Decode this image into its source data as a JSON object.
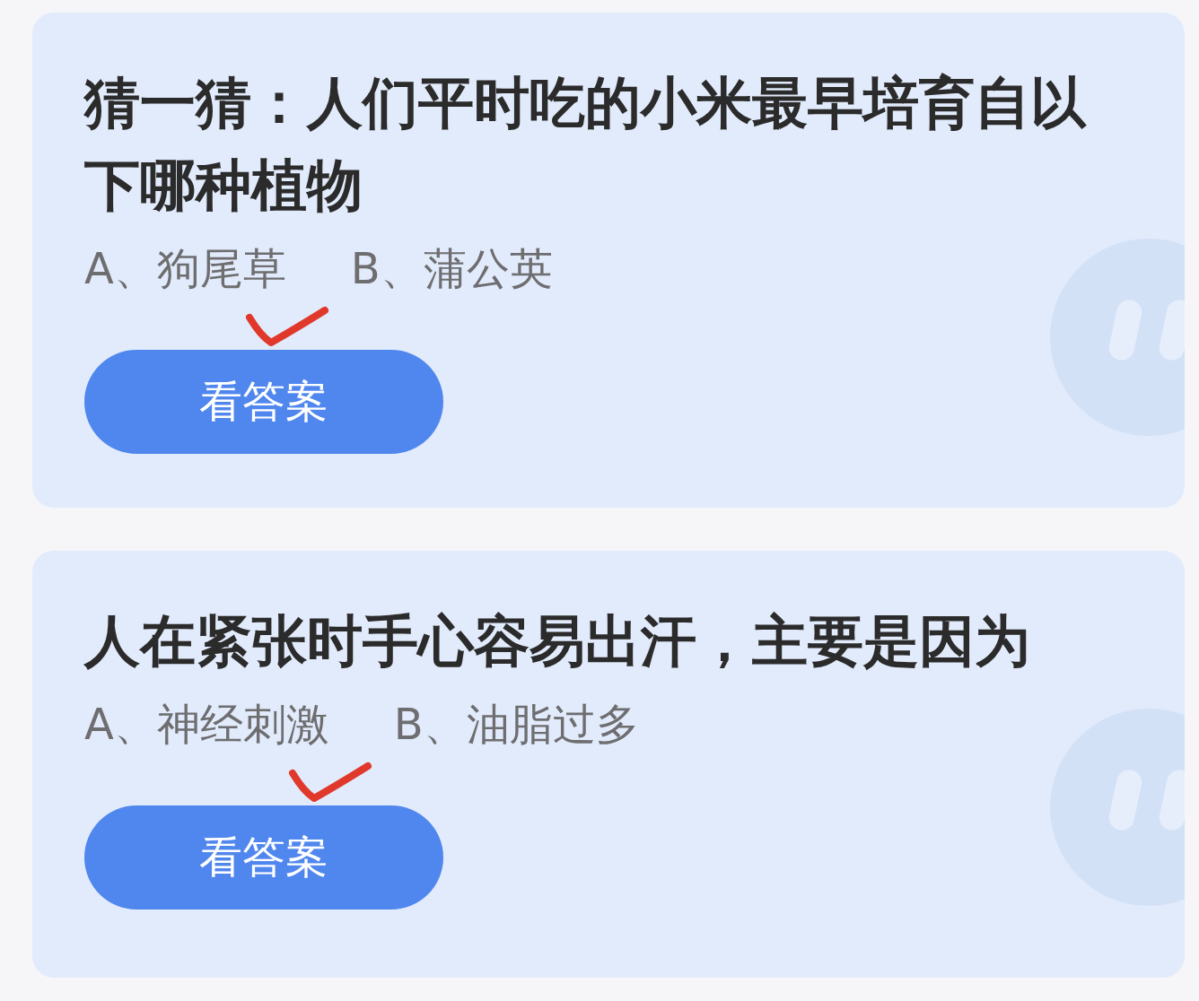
{
  "questions": [
    {
      "title": "猜一猜：人们平时吃的小米最早培育自以下哪种植物",
      "options": [
        {
          "text": "A、狗尾草",
          "marked": true
        },
        {
          "text": "B、蒲公英",
          "marked": false
        }
      ],
      "button": "看答案"
    },
    {
      "title": "人在紧张时手心容易出汗，主要是因为",
      "options": [
        {
          "text": "A、神经刺激",
          "marked": true
        },
        {
          "text": "B、油脂过多",
          "marked": false
        }
      ],
      "button": "看答案"
    }
  ]
}
